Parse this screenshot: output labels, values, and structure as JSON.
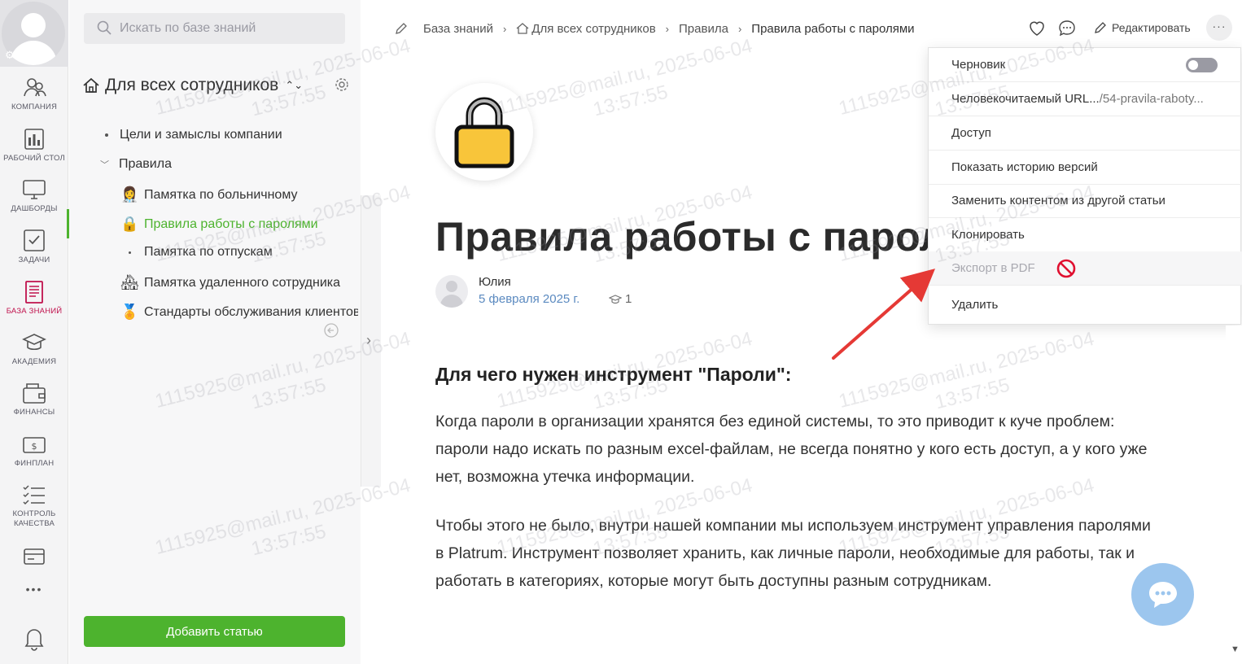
{
  "rail": {
    "items": [
      {
        "label": "КОМПАНИЯ",
        "icon": "company-icon"
      },
      {
        "label": "РАБОЧИЙ СТОЛ",
        "icon": "desktop-icon"
      },
      {
        "label": "ДАШБОРДЫ",
        "icon": "monitor-icon"
      },
      {
        "label": "ЗАДАЧИ",
        "icon": "tasks-icon"
      },
      {
        "label": "БАЗА ЗНАНИЙ",
        "icon": "knowledge-base-icon"
      },
      {
        "label": "АКАДЕМИЯ",
        "icon": "academy-icon"
      },
      {
        "label": "ФИНАНСЫ",
        "icon": "finance-icon"
      },
      {
        "label": "ФИНПЛАН",
        "icon": "finplan-icon"
      },
      {
        "label": "КОНТРОЛЬ КАЧЕСТВА",
        "icon": "quality-control-icon"
      }
    ],
    "more": "•••",
    "active_index": 4,
    "active_color": "#c0124d"
  },
  "tree": {
    "search_placeholder": "Искать по базе знаний",
    "root_title": "Для всех сотрудников",
    "nodes": [
      {
        "label": "Цели и замыслы компании",
        "icon": "bullet"
      },
      {
        "label": "Правила",
        "icon": "chevron-down"
      },
      {
        "label": "Памятка по больничному",
        "icon": "doctor-emoji"
      },
      {
        "label": "Правила работы с паролями",
        "icon": "lock-emoji",
        "active": true
      },
      {
        "label": "Памятка по отпускам",
        "icon": "bullet"
      },
      {
        "label": "Памятка удаленного сотрудника",
        "icon": "house-emoji"
      },
      {
        "label": "Стандарты обслуживания клиентов",
        "icon": "medal-emoji"
      }
    ],
    "add_button": "Добавить статью",
    "accent": "#4db32e"
  },
  "breadcrumbs": [
    "База знаний",
    "Для всех сотрудников",
    "Правила",
    "Правила работы с паролями"
  ],
  "toolbar": {
    "edit_label": "Редактировать",
    "more_label": "···"
  },
  "article": {
    "title": "Правила работы с паролями",
    "author": "Юлия",
    "date": "5 февраля 2025 г.",
    "views": "1",
    "heading": "Для чего нужен инструмент \"Пароли\":",
    "paragraphs": [
      "Когда пароли в организации хранятся без единой системы, то это приводит к куче проблем: пароли надо искать по разным excel-файлам, не всегда понятно у кого есть доступ, а у кого уже нет, возможна утечка информации.",
      "Чтобы этого не было, внутри нашей компании мы используем инструмент управления паролями в Platrum. Инструмент позволяет хранить, как личные пароли, необходимые для работы, так и работать в категориях, которые могут быть доступны разным сотрудникам."
    ]
  },
  "menu": {
    "draft": "Черновик",
    "draft_enabled": false,
    "url_label": "Человекочитаемый URL...",
    "url_value": "/54-pravila-raboty...",
    "access": "Доступ",
    "history": "Показать историю версий",
    "replace": "Заменить контентом из другой статьи",
    "clone": "Клонировать",
    "export_pdf": "Экспорт в PDF",
    "export_pdf_disabled": true,
    "delete": "Удалить"
  },
  "watermark": {
    "line1": "1115925@mail.ru, 2025-06-04",
    "line2": "13:57:55"
  }
}
